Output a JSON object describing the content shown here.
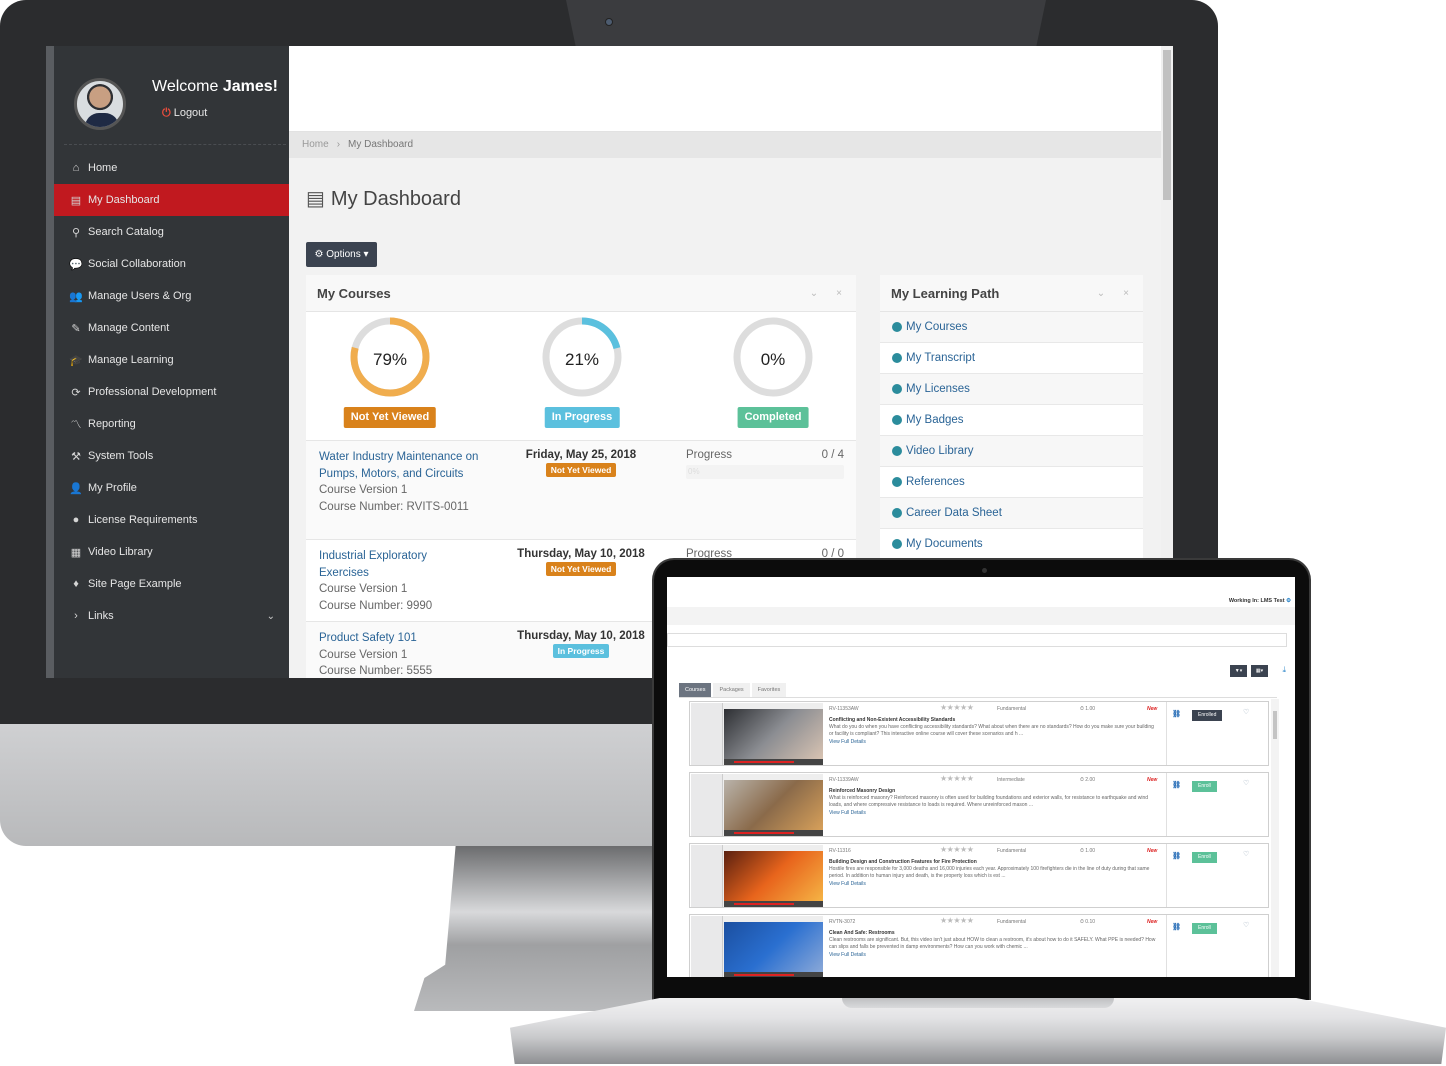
{
  "monitor": {
    "sidebar": {
      "welcome_prefix": "Welcome",
      "user_name": "James!",
      "logout_label": "Logout",
      "items": [
        {
          "label": "Home",
          "icon": "home-icon",
          "glyph": "⌂"
        },
        {
          "label": "My Dashboard",
          "icon": "book-icon",
          "glyph": "▤",
          "active": true
        },
        {
          "label": "Search Catalog",
          "icon": "search-icon",
          "glyph": "⚲"
        },
        {
          "label": "Social Collaboration",
          "icon": "chat-bubbles-icon",
          "glyph": "💬"
        },
        {
          "label": "Manage Users & Org",
          "icon": "users-icon",
          "glyph": "👥"
        },
        {
          "label": "Manage Content",
          "icon": "edit-icon",
          "glyph": "✎"
        },
        {
          "label": "Manage Learning",
          "icon": "graduation-cap-icon",
          "glyph": "🎓"
        },
        {
          "label": "Professional Development",
          "icon": "refresh-icon",
          "glyph": "⟳"
        },
        {
          "label": "Reporting",
          "icon": "chart-line-icon",
          "glyph": "〽"
        },
        {
          "label": "System Tools",
          "icon": "tools-icon",
          "glyph": "⚒"
        },
        {
          "label": "My Profile",
          "icon": "user-icon",
          "glyph": "👤"
        },
        {
          "label": "License Requirements",
          "icon": "certificate-icon",
          "glyph": "●"
        },
        {
          "label": "Video Library",
          "icon": "film-icon",
          "glyph": "▦"
        },
        {
          "label": "Site Page Example",
          "icon": "page-icon",
          "glyph": "♦"
        },
        {
          "label": "Links",
          "icon": "chevron-right-icon",
          "glyph": "›",
          "expandable": true
        }
      ]
    },
    "breadcrumb": {
      "home": "Home",
      "separator": "›",
      "current": "My Dashboard"
    },
    "page_title": "My Dashboard",
    "options_button": "⚙ Options ▾",
    "my_courses": {
      "title": "My Courses",
      "collapse_glyph": "⌄",
      "close_glyph": "×",
      "status_colors": {
        "not_yet_viewed": "#d9821b",
        "in_progress": "#5bc0de",
        "completed": "#5cc199",
        "track": "#dddddd"
      },
      "summary": [
        {
          "percent": 79,
          "percent_label": "79%",
          "label": "Not Yet Viewed",
          "color": "#f0ad4e",
          "badge_color": "#d9821b"
        },
        {
          "percent": 21,
          "percent_label": "21%",
          "label": "In Progress",
          "color": "#5bc0de",
          "badge_color": "#5bc0de"
        },
        {
          "percent": 0,
          "percent_label": "0%",
          "label": "Completed",
          "color": "#5cc199",
          "badge_color": "#5cc199"
        }
      ],
      "courses": [
        {
          "title": "Water Industry Maintenance on Pumps, Motors, and Circuits",
          "version": "Course Version 1",
          "number": "Course Number: RVITS-0011",
          "date": "Friday, May 25, 2018",
          "status": "Not Yet Viewed",
          "status_color": "#d9821b",
          "progress_label": "Progress",
          "progress_count": "0 / 4",
          "progress_percent": "0%"
        },
        {
          "title": "Industrial Exploratory Exercises",
          "version": "Course Version 1",
          "number": "Course Number: 9990",
          "date": "Thursday, May 10, 2018",
          "status": "Not Yet Viewed",
          "status_color": "#d9821b",
          "progress_label": "Progress",
          "progress_count": "0 / 0"
        },
        {
          "title": "Product Safety 101",
          "version": "Course Version 1",
          "number": "Course Number: 5555",
          "date": "Thursday, May 10, 2018",
          "status": "In Progress",
          "status_color": "#5bc0de"
        }
      ]
    },
    "learning_path": {
      "title": "My Learning Path",
      "collapse_glyph": "⌄",
      "close_glyph": "×",
      "items": [
        "My Courses",
        "My Transcript",
        "My Licenses",
        "My Badges",
        "Video Library",
        "References",
        "Career Data Sheet",
        "My Documents"
      ]
    }
  },
  "laptop": {
    "working_in": "Working In: LMS Test",
    "search_placeholder": "",
    "filter_button": "▼▾",
    "columns_button": "▦▾",
    "download_glyph": "⤓",
    "tabs": [
      "Courses",
      "Packages",
      "Favorites"
    ],
    "courses": [
      {
        "code": "RV-11353AW",
        "rating": "★★★★★",
        "level": "Fundamental",
        "duration": "⏱ 1.00",
        "flag": "New",
        "title": "Conflicting and Non-Existent Accessibility Standards",
        "description": "What do you do when you have conflicting accessibility standards? What about when there are no standards? How do you make sure your building or facility is compliant? This interactive online course will cover these scenarios and h ...",
        "link": "View Full Details",
        "action": "Enrolled",
        "action_color": "#3b4350",
        "thumb_colors": [
          "#2d2f33",
          "#8b8d92",
          "#d8c3b2"
        ]
      },
      {
        "code": "RV-11339AW",
        "rating": "★★★★★",
        "level": "Intermediate",
        "duration": "⏱ 2.00",
        "flag": "New",
        "title": "Reinforced Masonry Design",
        "description": "What is reinforced masonry? Reinforced masonry is often used for building foundations and exterior walls, for resistance to earthquake and wind loads, and where compressive resistance to loads is required. Where unreinforced mason ...",
        "link": "View Full Details",
        "action": "Enroll",
        "action_color": "#5cc199",
        "thumb_colors": [
          "#b9b3aa",
          "#8a6a4a",
          "#d7a05a"
        ]
      },
      {
        "code": "RV-11316",
        "rating": "★★★★★",
        "level": "Fundamental",
        "duration": "⏱ 1.00",
        "flag": "New",
        "title": "Building Design and Construction Features for Fire Protection",
        "description": "Hostile fires are responsible for 3,000 deaths and 16,000 injuries each year. Approximately 100 firefighters die in the line of duty during that same period. In addition to human injury and death, is the property loss which is est ...",
        "link": "View Full Details",
        "action": "Enroll",
        "action_color": "#5cc199",
        "thumb_colors": [
          "#5a2010",
          "#e8641c",
          "#f5b445"
        ]
      },
      {
        "code": "RVTN-3072",
        "rating": "★★★★★",
        "level": "Fundamental",
        "duration": "⏱ 0.10",
        "flag": "New",
        "title": "Clean And Safe: Restrooms",
        "description": "Clean restrooms are significant. But, this video isn't just about HOW to clean a restroom, it's about how to do it SAFELY. What PPE is needed? How can slips and falls be prevented in damp environments? How can you work with chemic ...",
        "link": "View Full Details",
        "action": "Enroll",
        "action_color": "#5cc199",
        "thumb_colors": [
          "#1b4fa0",
          "#2a6fd0",
          "#8aa8d8"
        ]
      }
    ]
  }
}
